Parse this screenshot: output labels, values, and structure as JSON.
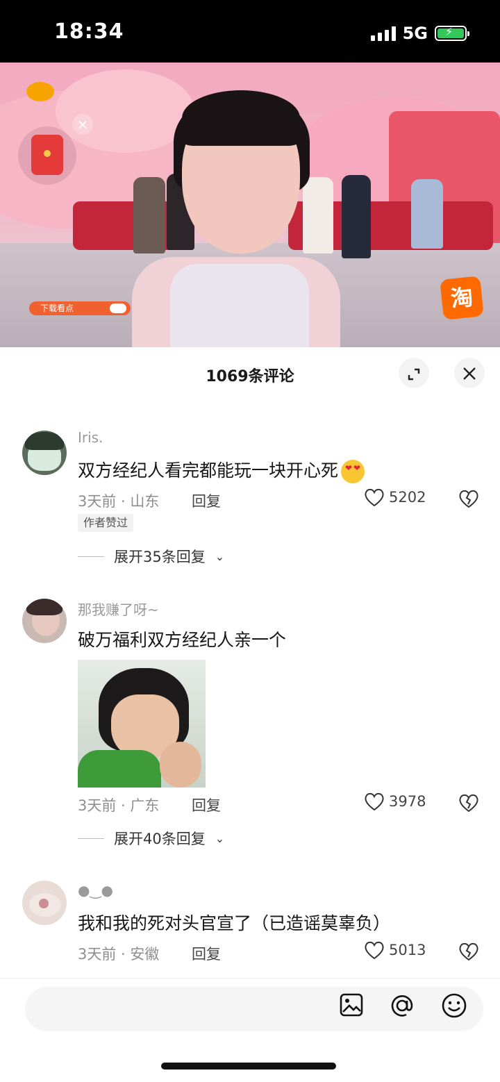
{
  "status_bar": {
    "time": "18:34",
    "network": "5G",
    "battery_icon": "battery-charging-icon",
    "signal_icon": "signal-bars-icon"
  },
  "video": {
    "promo_text": "下载看点",
    "shop_label": "淘",
    "close_label": "×"
  },
  "comments_panel": {
    "title": "1069条评论",
    "expand_icon": "expand-icon",
    "close_icon": "close-icon"
  },
  "comments": [
    {
      "username": "Iris.",
      "text": "双方经纪人看完都能玩一块开心死",
      "emoji": "heart-eyes-emoji",
      "time_location": "3天前 · 山东",
      "reply_label": "回复",
      "likes": "5202",
      "badge": "作者赞过",
      "expand_label": "展开35条回复"
    },
    {
      "username": "那我赚了呀~",
      "text": "破万福利双方经纪人亲一个",
      "time_location": "3天前 · 广东",
      "reply_label": "回复",
      "likes": "3978",
      "expand_label": "展开40条回复"
    },
    {
      "username": "●‿●",
      "text": "我和我的死对头官宣了（已造谣莫辜负）",
      "time_location": "3天前 · 安徽",
      "reply_label": "回复",
      "likes": "5013"
    }
  ],
  "input_bar": {
    "icons": [
      "image-icon",
      "at-icon",
      "emoji-icon"
    ]
  },
  "colors": {
    "accent_orange": "#ff6a00",
    "red_packet": "#e43a3a",
    "text_primary": "#161616",
    "text_secondary": "#8e8e8e"
  }
}
